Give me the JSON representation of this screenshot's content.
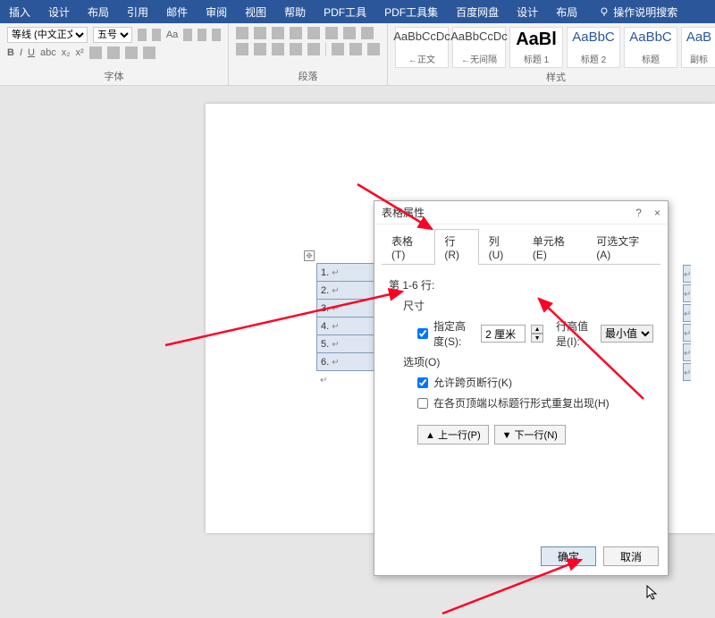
{
  "menu": {
    "items": [
      "插入",
      "设计",
      "布局",
      "引用",
      "邮件",
      "审阅",
      "视图",
      "帮助",
      "PDF工具",
      "PDF工具集",
      "百度网盘",
      "设计",
      "布局"
    ],
    "search": "操作说明搜索"
  },
  "ribbon": {
    "font": {
      "name_sel": "等线 (中文正文)",
      "size_sel": "五号",
      "group_label": "字体"
    },
    "para": {
      "group_label": "段落"
    },
    "styles": {
      "group_label": "样式",
      "items": [
        {
          "sample": "AaBbCcDc",
          "name": "←正文"
        },
        {
          "sample": "AaBbCcDc",
          "name": "←无间隔"
        },
        {
          "sample": "AaBl",
          "name": "标题 1"
        },
        {
          "sample": "AaBbC",
          "name": "标题 2"
        },
        {
          "sample": "AaBbC",
          "name": "标题"
        },
        {
          "sample": "AaB",
          "name": "副标"
        }
      ]
    }
  },
  "table_rows": [
    "1.",
    "2.",
    "3.",
    "4.",
    "5.",
    "6."
  ],
  "dialog": {
    "title": "表格属性",
    "help": "?",
    "close": "×",
    "tabs": {
      "table": "表格(T)",
      "row": "行(R)",
      "col": "列(U)",
      "cell": "单元格(E)",
      "alt": "可选文字(A)"
    },
    "rows_label": "第 1-6 行:",
    "size_label": "尺寸",
    "spec_height": "指定高度(S):",
    "height_val": "2 厘米",
    "row_height_is": "行高值是(I):",
    "row_height_mode": "最小值",
    "options_label": "选项(O)",
    "allow_break": "允许跨页断行(K)",
    "repeat_header": "在各页顶端以标题行形式重复出现(H)",
    "prev_row": "▲ 上一行(P)",
    "next_row": "▼ 下一行(N)",
    "ok": "确定",
    "cancel": "取消"
  }
}
